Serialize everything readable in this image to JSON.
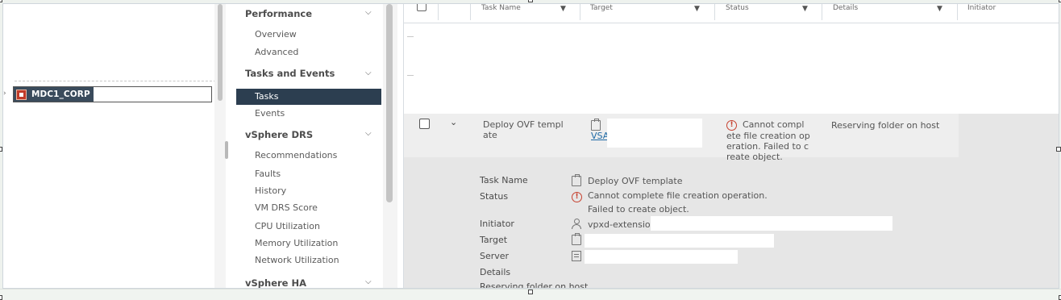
{
  "tree": {
    "selected_item": "MDC1_CORP"
  },
  "nav": {
    "sections": [
      {
        "label": "Performance",
        "items": [
          "Overview",
          "Advanced"
        ]
      },
      {
        "label": "Tasks and Events",
        "items": [
          "Tasks",
          "Events"
        ],
        "active": "Tasks"
      },
      {
        "label": "vSphere DRS",
        "items": [
          "Recommendations",
          "Faults",
          "History",
          "VM DRS Score",
          "CPU Utilization",
          "Memory Utilization",
          "Network Utilization"
        ]
      },
      {
        "label": "vSphere HA",
        "items": []
      }
    ]
  },
  "grid": {
    "columns": [
      "Task Name",
      "Target",
      "Status",
      "Details",
      "Initiator"
    ],
    "row": {
      "task_name_line1": "Deploy OVF templ",
      "task_name_line2": "ate",
      "target_link": "VSA",
      "status_lines": [
        "Cannot compl",
        "ete file creation op",
        "eration. Failed to c",
        "reate object."
      ],
      "details": "Reserving folder on host"
    }
  },
  "detail": {
    "labels": {
      "task_name": "Task Name",
      "status": "Status",
      "initiator": "Initiator",
      "target": "Target",
      "server": "Server",
      "details": "Details"
    },
    "values": {
      "task_name": "Deploy OVF template",
      "status_line1": "Cannot complete file creation operation.",
      "status_line2": "Failed to create object.",
      "initiator": "vpxd-extension",
      "details": "Reserving folder on host"
    }
  },
  "colors": {
    "accent_nav": "#2c3e50",
    "error": "#c6412f",
    "link": "#1f6aa5"
  }
}
